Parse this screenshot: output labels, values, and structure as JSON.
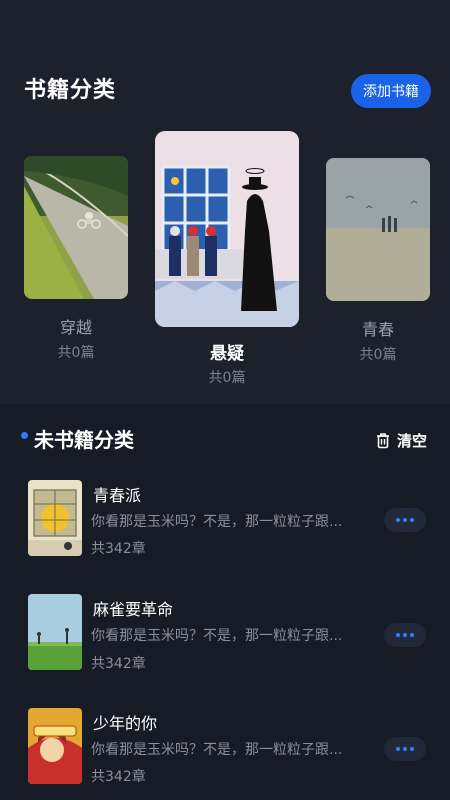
{
  "categories_section": {
    "title": "书籍分类",
    "add_button": "添加书籍",
    "cards": [
      {
        "name": "穿越",
        "count": "共0篇"
      },
      {
        "name": "悬疑",
        "count": "共0篇"
      },
      {
        "name": "青春",
        "count": "共0篇"
      }
    ]
  },
  "uncategorized_section": {
    "title": "未书籍分类",
    "clear_button": "清空",
    "items": [
      {
        "title": "青春派",
        "desc": "你看那是玉米吗？不是，那一粒粒子跟...",
        "count": "共342章"
      },
      {
        "title": "麻雀要革命",
        "desc": "你看那是玉米吗？不是，那一粒粒子跟...",
        "count": "共342章"
      },
      {
        "title": "少年的你",
        "desc": "你看那是玉米吗？不是，那一粒粒子跟...",
        "count": "共342章"
      }
    ]
  },
  "colors": {
    "accent": "#1a63e8",
    "background": "#161b25",
    "panel": "#1c212c"
  }
}
